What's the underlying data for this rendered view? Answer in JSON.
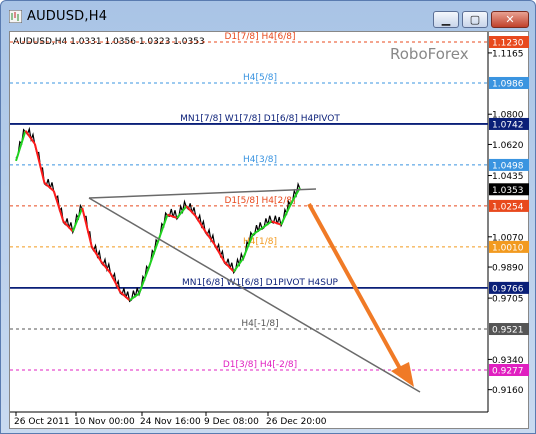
{
  "window": {
    "title": "AUDUSD,H4",
    "min_icon": "minimize-icon",
    "max_icon": "maximize-icon",
    "close_icon": "close-icon"
  },
  "chart_header": "AUDUSD,H4  1.0331 1.0356 1.0323 1.0353",
  "watermark": "RoboForex",
  "levels": [
    {
      "label": "D1[7/8] H4[6/8]",
      "price": "1.1230",
      "color": "#e8491d",
      "style": "dash",
      "boxed": true
    },
    {
      "label": "",
      "price": "1.1165",
      "color": "#000000",
      "style": "none",
      "boxed": false
    },
    {
      "label": "H4[5/8]",
      "price": "1.0986",
      "color": "#3a94e0",
      "style": "dash",
      "boxed": true
    },
    {
      "label": "",
      "price": "1.0800",
      "color": "#000000",
      "style": "none",
      "boxed": false
    },
    {
      "label": "MN1[7/8] W1[7/8] D1[6/8] H4PIVOT",
      "price": "1.0742",
      "color": "#0a1f78",
      "style": "solid",
      "boxed": true
    },
    {
      "label": "",
      "price": "1.0620",
      "color": "#000000",
      "style": "none",
      "boxed": false
    },
    {
      "label": "H4[3/8]",
      "price": "1.0498",
      "color": "#3a94e0",
      "style": "dash",
      "boxed": true
    },
    {
      "label": "",
      "price": "1.0435",
      "color": "#000000",
      "style": "none",
      "boxed": false
    },
    {
      "label": "",
      "price": "1.0353",
      "color": "#000000",
      "style": "none",
      "boxed": true
    },
    {
      "label": "D1[5/8] H4[2/8]",
      "price": "1.0254",
      "color": "#e8491d",
      "style": "dash",
      "boxed": true
    },
    {
      "label": "",
      "price": "1.0070",
      "color": "#000000",
      "style": "none",
      "boxed": false
    },
    {
      "label": "H4[1/8]",
      "price": "1.0010",
      "color": "#f29a1f",
      "style": "dash",
      "boxed": true
    },
    {
      "label": "",
      "price": "0.9890",
      "color": "#000000",
      "style": "none",
      "boxed": false
    },
    {
      "label": "MN1[6/8] W1[6/8] D1PIVOT H4SUP",
      "price": "0.9766",
      "color": "#0a1f78",
      "style": "solid",
      "boxed": true
    },
    {
      "label": "",
      "price": "0.9705",
      "color": "#000000",
      "style": "none",
      "boxed": false
    },
    {
      "label": "H4[-1/8]",
      "price": "0.9521",
      "color": "#555555",
      "style": "dash",
      "boxed": true
    },
    {
      "label": "",
      "price": "0.9340",
      "color": "#000000",
      "style": "none",
      "boxed": false
    },
    {
      "label": "D1[3/8] H4[-2/8]",
      "price": "0.9277",
      "color": "#e020c0",
      "style": "dash",
      "boxed": true
    },
    {
      "label": "",
      "price": "0.9160",
      "color": "#000000",
      "style": "none",
      "boxed": false
    }
  ],
  "x_axis": [
    "26 Oct 2011",
    "10 Nov 00:00",
    "24 Nov 16:00",
    "9 Dec 08:00",
    "26 Dec 20:00"
  ],
  "chart_data": {
    "type": "line",
    "title": "AUDUSD,H4",
    "x": [
      "26 Oct 2011",
      "10 Nov 00:00",
      "24 Nov 16:00",
      "9 Dec 08:00",
      "26 Dec 20:00"
    ],
    "ylim": [
      0.916,
      1.123
    ],
    "series": [
      {
        "name": "",
        "values": [
          1.054,
          1.072,
          1.064,
          1.041,
          1.036,
          1.018,
          1.012,
          1.026,
          1.003,
          0.994,
          0.987,
          0.976,
          0.971,
          0.975,
          0.99,
          1.006,
          1.022,
          1.02,
          1.027,
          1.021,
          1.012,
          1.004,
          0.994,
          0.988,
          0.996,
          1.01,
          1.014,
          1.018,
          1.016,
          1.028,
          1.038
        ]
      }
    ]
  }
}
